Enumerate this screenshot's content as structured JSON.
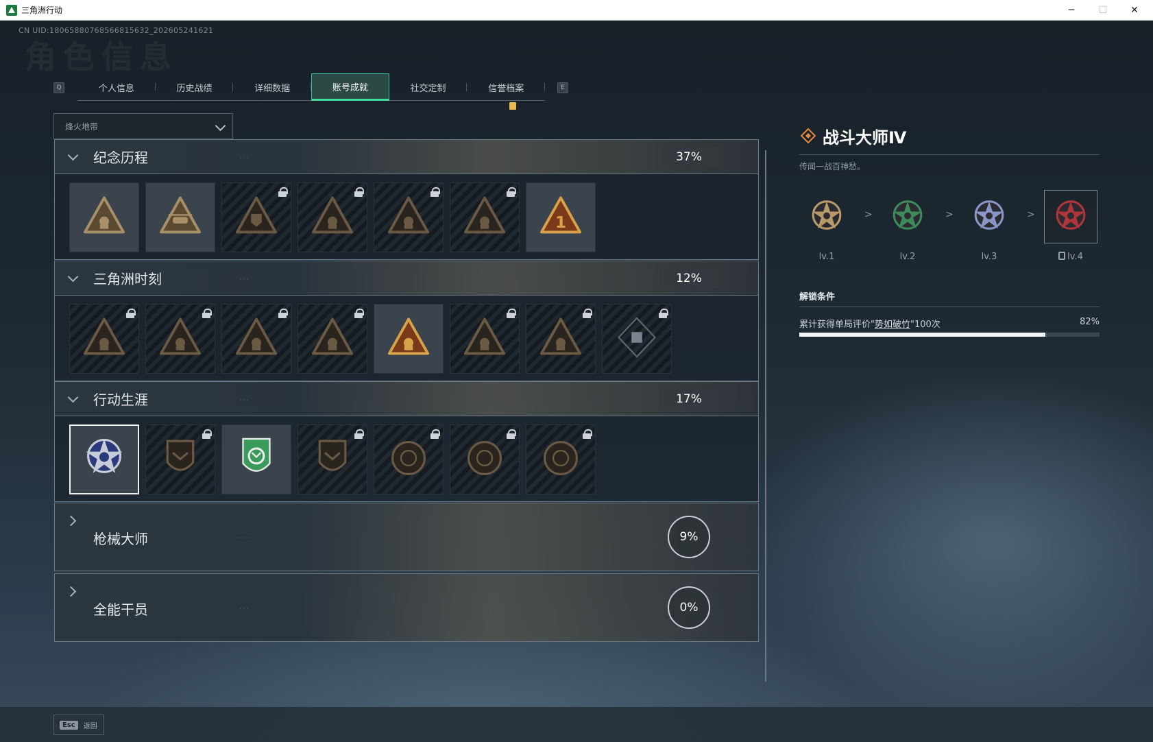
{
  "window": {
    "title": "三角洲行动",
    "min": "─",
    "max": "☐",
    "close": "✕"
  },
  "uid": "CN UID:18065880768566815632_202605241621",
  "bg_title": "角色信息",
  "tabbar": {
    "left_key": "Q",
    "right_key": "E",
    "tabs": [
      "个人信息",
      "历史战绩",
      "详细数据",
      "账号成就",
      "社交定制",
      "信誉档案"
    ],
    "active": "账号成就"
  },
  "mode_select": {
    "value": "烽火地带"
  },
  "sections": [
    {
      "title": "纪念历程",
      "progress": "37%",
      "expanded": true,
      "items": [
        {
          "icon": "mountain-triangle-badge",
          "locked": false,
          "tone": "bronze"
        },
        {
          "icon": "helicopter-badge",
          "locked": false,
          "tone": "bronze"
        },
        {
          "icon": "shield-emblem-badge",
          "locked": true,
          "tone": "dark"
        },
        {
          "icon": "radio-soldier-badge",
          "locked": true,
          "tone": "dark"
        },
        {
          "icon": "hooded-soldier-badge",
          "locked": true,
          "tone": "dark"
        },
        {
          "icon": "crossed-guns-badge",
          "locked": true,
          "tone": "dark"
        },
        {
          "icon": "number-one-badge",
          "locked": false,
          "tone": "gold"
        }
      ]
    },
    {
      "title": "三角洲时刻",
      "progress": "12%",
      "expanded": true,
      "items": [
        {
          "icon": "backpack-triangle-badge",
          "locked": true,
          "tone": "dark"
        },
        {
          "icon": "armor-triangle-badge",
          "locked": true,
          "tone": "dark"
        },
        {
          "icon": "kneeling-soldier-badge",
          "locked": true,
          "tone": "dark"
        },
        {
          "icon": "dice-triangle-badge",
          "locked": true,
          "tone": "dark"
        },
        {
          "icon": "squad-triangle-badge",
          "locked": false,
          "tone": "gold"
        },
        {
          "icon": "soldier-group-badge",
          "locked": true,
          "tone": "dark"
        },
        {
          "icon": "dragon-triangle-badge",
          "locked": true,
          "tone": "dark"
        },
        {
          "icon": "cube-diamond-badge",
          "locked": true,
          "tone": "dark"
        }
      ]
    },
    {
      "title": "行动生涯",
      "progress": "17%",
      "expanded": true,
      "items": [
        {
          "icon": "star-skull-medal",
          "locked": false,
          "tone": "silver",
          "selected": true
        },
        {
          "icon": "chevron-shield-medal",
          "locked": true,
          "tone": "dark"
        },
        {
          "icon": "green-shield-medal",
          "locked": false,
          "tone": "green"
        },
        {
          "icon": "hexagon-shield-medal",
          "locked": true,
          "tone": "dark"
        },
        {
          "icon": "planet-circle-medal",
          "locked": true,
          "tone": "dark"
        },
        {
          "icon": "crosshair-skull-medal",
          "locked": true,
          "tone": "dark"
        },
        {
          "icon": "eye-circle-medal",
          "locked": true,
          "tone": "dark"
        }
      ]
    },
    {
      "title": "枪械大师",
      "progress": "9%",
      "expanded": false
    },
    {
      "title": "全能干员",
      "progress": "0%",
      "expanded": false
    }
  ],
  "detail": {
    "name": "战斗大师Ⅳ",
    "desc": "传闻一战百神愁。",
    "levels": [
      {
        "label": "lv.1",
        "color": "#b79a6a"
      },
      {
        "label": "lv.2",
        "color": "#3f8a5a"
      },
      {
        "label": "lv.3",
        "color": "#8a95c8"
      },
      {
        "label": "lv.4",
        "color": "#b0353a"
      }
    ],
    "sep": ">",
    "unlock_title": "解锁条件",
    "condition_prefix": "累计获得单局评价\"",
    "condition_key": "势如破竹",
    "condition_suffix": "\"100次",
    "condition_progress": "82%",
    "progress_value": 0.82
  },
  "footer": {
    "esc_key": "Esc",
    "esc_label": "返回"
  }
}
